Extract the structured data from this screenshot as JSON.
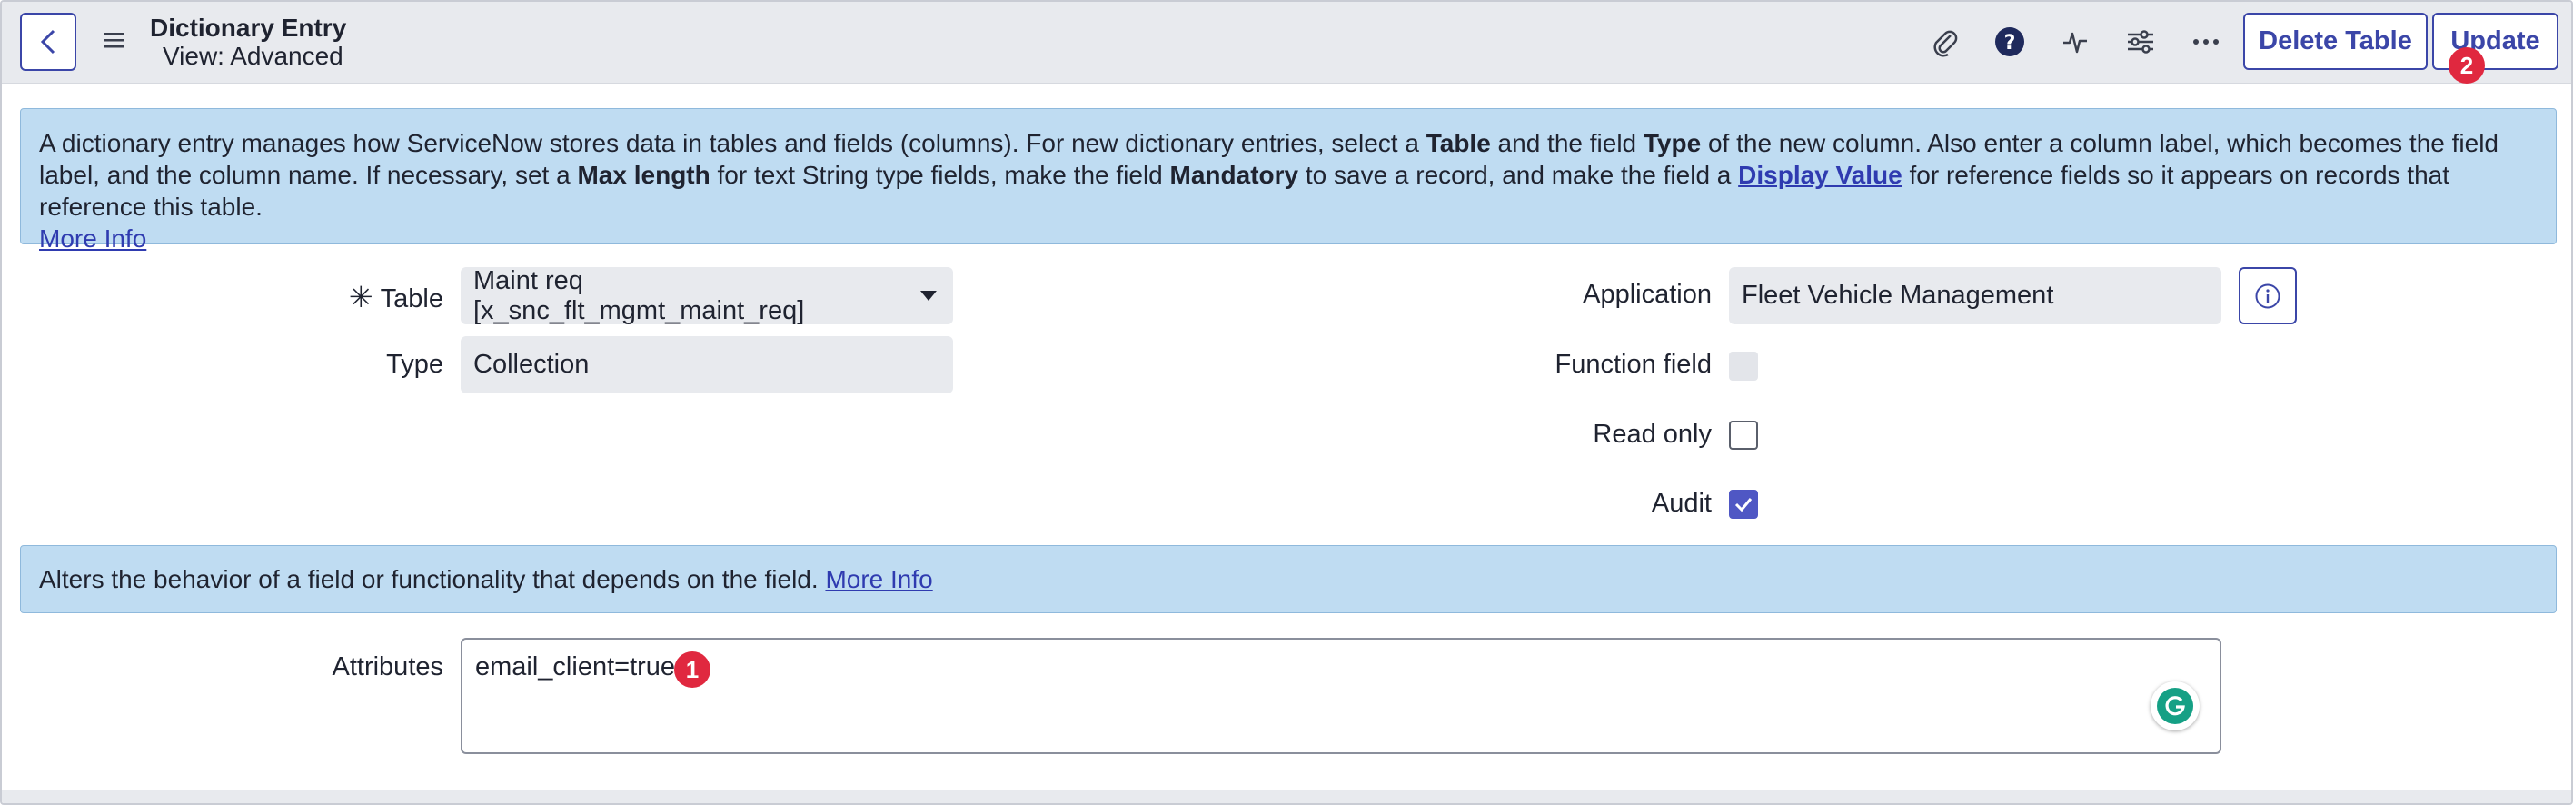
{
  "header": {
    "title": "Dictionary Entry",
    "view": "View: Advanced",
    "delete_table_label": "Delete Table",
    "update_label": "Update",
    "update_badge": "2",
    "icons": [
      "back-icon",
      "hamburger-icon",
      "paperclip-icon",
      "help-icon",
      "activity-icon",
      "settings-sliders-icon",
      "more-icon"
    ]
  },
  "info_banner": {
    "t1": "A dictionary entry manages how ServiceNow stores data in tables and fields (columns). For new dictionary entries, select a ",
    "b1": "Table",
    "t2": " and the field ",
    "b2": "Type",
    "t3": " of the new column. Also enter a column label, which becomes the field label, and the column name. If necessary, set a ",
    "b3": "Max length",
    "t4": " for text String type fields, make the field ",
    "b4": "Mandatory",
    "t5": " to save a record, and make the field a ",
    "link_display_value": "Display Value",
    "t6": " for reference fields so it appears on records that reference this table.",
    "more_info": "More Info"
  },
  "form": {
    "table_label": "Table",
    "table_value": "Maint req [x_snc_flt_mgmt_maint_req]",
    "type_label": "Type",
    "type_value": "Collection",
    "application_label": "Application",
    "application_value": "Fleet Vehicle Management",
    "function_field_label": "Function field",
    "function_field_checked": false,
    "read_only_label": "Read only",
    "read_only_checked": false,
    "audit_label": "Audit",
    "audit_checked": true
  },
  "attributes_banner": {
    "text": "Alters the behavior of a field or functionality that depends on the field.",
    "more_info": "More Info"
  },
  "attributes": {
    "label": "Attributes",
    "value": "email_client=true",
    "badge": "1"
  },
  "colors": {
    "accent": "#3b46a8",
    "banner_bg": "#bfdcf2",
    "badge_red": "#e0283f",
    "checkbox_checked": "#4f57c4",
    "grammarly_green": "#15a085"
  }
}
